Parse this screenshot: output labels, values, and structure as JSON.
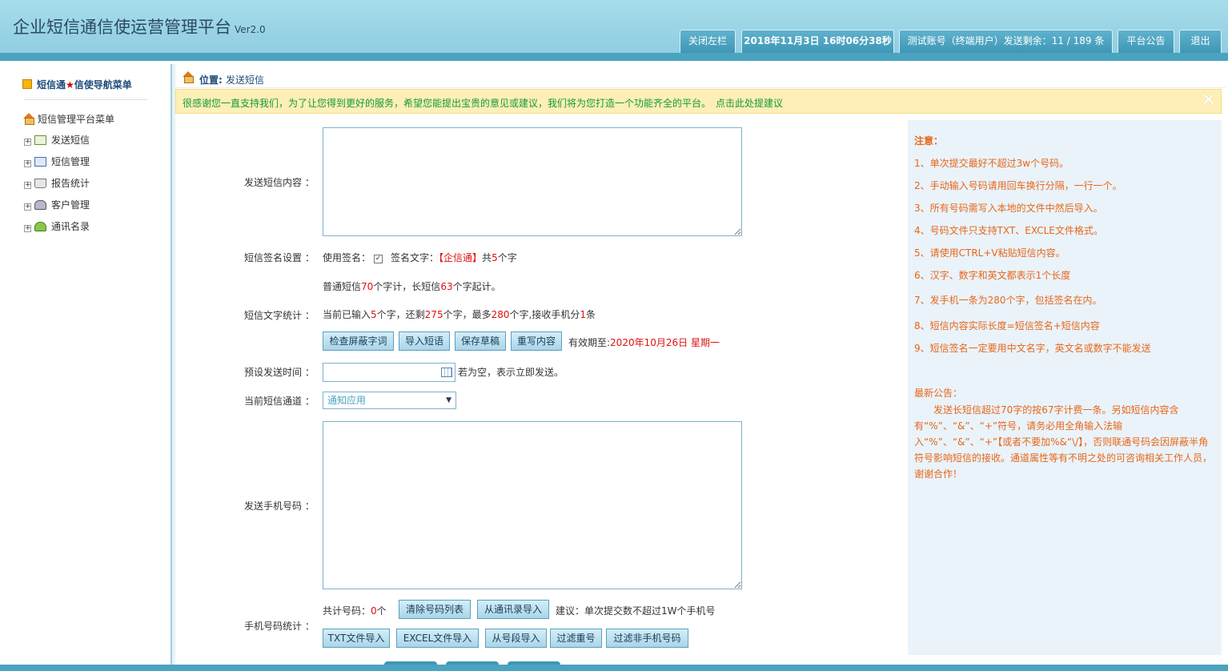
{
  "header": {
    "title": "企业短信通信使运营管理平台",
    "version": "Ver2.0",
    "buttons": {
      "close_left": "关闭左栏",
      "datetime": "2018年11月3日 16时06分38秒",
      "account": "测试账号（终端用户）发送剩余：11 / 189 条",
      "announcement": "平台公告",
      "logout": "退出"
    }
  },
  "sidebar": {
    "title_pre": "短信通",
    "title_star": "★",
    "title_post": "信使导航菜单",
    "root": "短信管理平台菜单",
    "items": [
      {
        "label": "发送短信",
        "icon": "mail-icon"
      },
      {
        "label": "短信管理",
        "icon": "list-icon"
      },
      {
        "label": "报告统计",
        "icon": "cart-icon"
      },
      {
        "label": "客户管理",
        "icon": "users-icon"
      },
      {
        "label": "通讯名录",
        "icon": "contact-icon"
      }
    ]
  },
  "breadcrumb": {
    "label": "位置:",
    "value": "发送短信"
  },
  "notice": {
    "text": "很感谢您一直支持我们，为了让您得到更好的服务，希望您能提出宝贵的意见或建议，我们将为您打造一个功能齐全的平台。",
    "link": "点击此处提建议",
    "close": "✕"
  },
  "form": {
    "content_label": "发送短信内容 ：",
    "signature_label": "短信签名设置 ：",
    "use_signature": "使用签名：",
    "signature_text_label": "签名文字：",
    "signature_value": "【企信通】",
    "signature_count_pre": "共",
    "signature_count": "5",
    "signature_count_post": "个字",
    "rule_pre": "普通短信",
    "rule_normal": "70",
    "rule_mid": "个字计，长短信",
    "rule_long": "63",
    "rule_post": "个字起计。",
    "stats_label": "短信文字统计 ：",
    "stats": {
      "p1": "当前已输入",
      "entered": "5",
      "p2": "个字，还剩",
      "remaining": "275",
      "p3": "个字，最多",
      "max": "280",
      "p4": "个字,接收手机分",
      "parts": "1",
      "p5": "条"
    },
    "buttons": {
      "check_words": "检查屏蔽字词",
      "import_phrases": "导入短语",
      "save_draft": "保存草稿",
      "rewrite": "重写内容"
    },
    "expiry_label": "有效期至:",
    "expiry_value": "2020年10月26日 星期一",
    "schedule_label": "预设发送时间 ：",
    "schedule_hint": "若为空，表示立即发送。",
    "channel_label": "当前短信通道 ：",
    "channel_value": "通知应用",
    "phones_label": "发送手机号码 ：",
    "phone_stats_label": "手机号码统计 ：",
    "phone_count_pre": "共计号码：",
    "phone_count": "0",
    "phone_count_post": "个",
    "phone_buttons": {
      "clear": "清除号码列表",
      "from_contacts": "从通讯录导入",
      "txt": "TXT文件导入",
      "excel": "EXCEL文件导入",
      "range": "从号段导入",
      "dedupe": "过滤重号",
      "filter_non": "过滤非手机号码"
    },
    "phone_advice": "建议：单次提交数不超过1W个手机号"
  },
  "notes": {
    "title": "注意：",
    "items": [
      "1、单次提交最好不超过3w个号码。",
      "2、手动输入号码请用回车换行分隔，一行一个。",
      "3、所有号码需写入本地的文件中然后导入。",
      "4、号码文件只支持TXT、EXCLE文件格式。",
      "5、请使用CTRL+V粘贴短信内容。",
      "6、汉字、数字和英文都表示1个长度",
      "7、发手机一条为280个字，包括签名在内。",
      "8、短信内容实际长度=短信签名+短信内容",
      "9、短信签名一定要用中文名字，英文名或数字不能发送"
    ],
    "latest_title": "最新公告：",
    "latest_text": "发送长短信超过70字的按67字计费一条。另如短信内容含有“%”、“&”、“+”符号，请务必用全角输入法输入“%”、“&”、“+”【或者不要加%&“\\/】，否则联通号码会因屏蔽半角符号影响短信的接收。通道属性等有不明之处的可咨询相关工作人员，谢谢合作！"
  },
  "colors": {
    "header": "#8ccbdf",
    "accent": "#4aa3bf",
    "warning_text": "#e8661a",
    "notice_bg": "#fdefb6",
    "highlight": "#e01010"
  }
}
